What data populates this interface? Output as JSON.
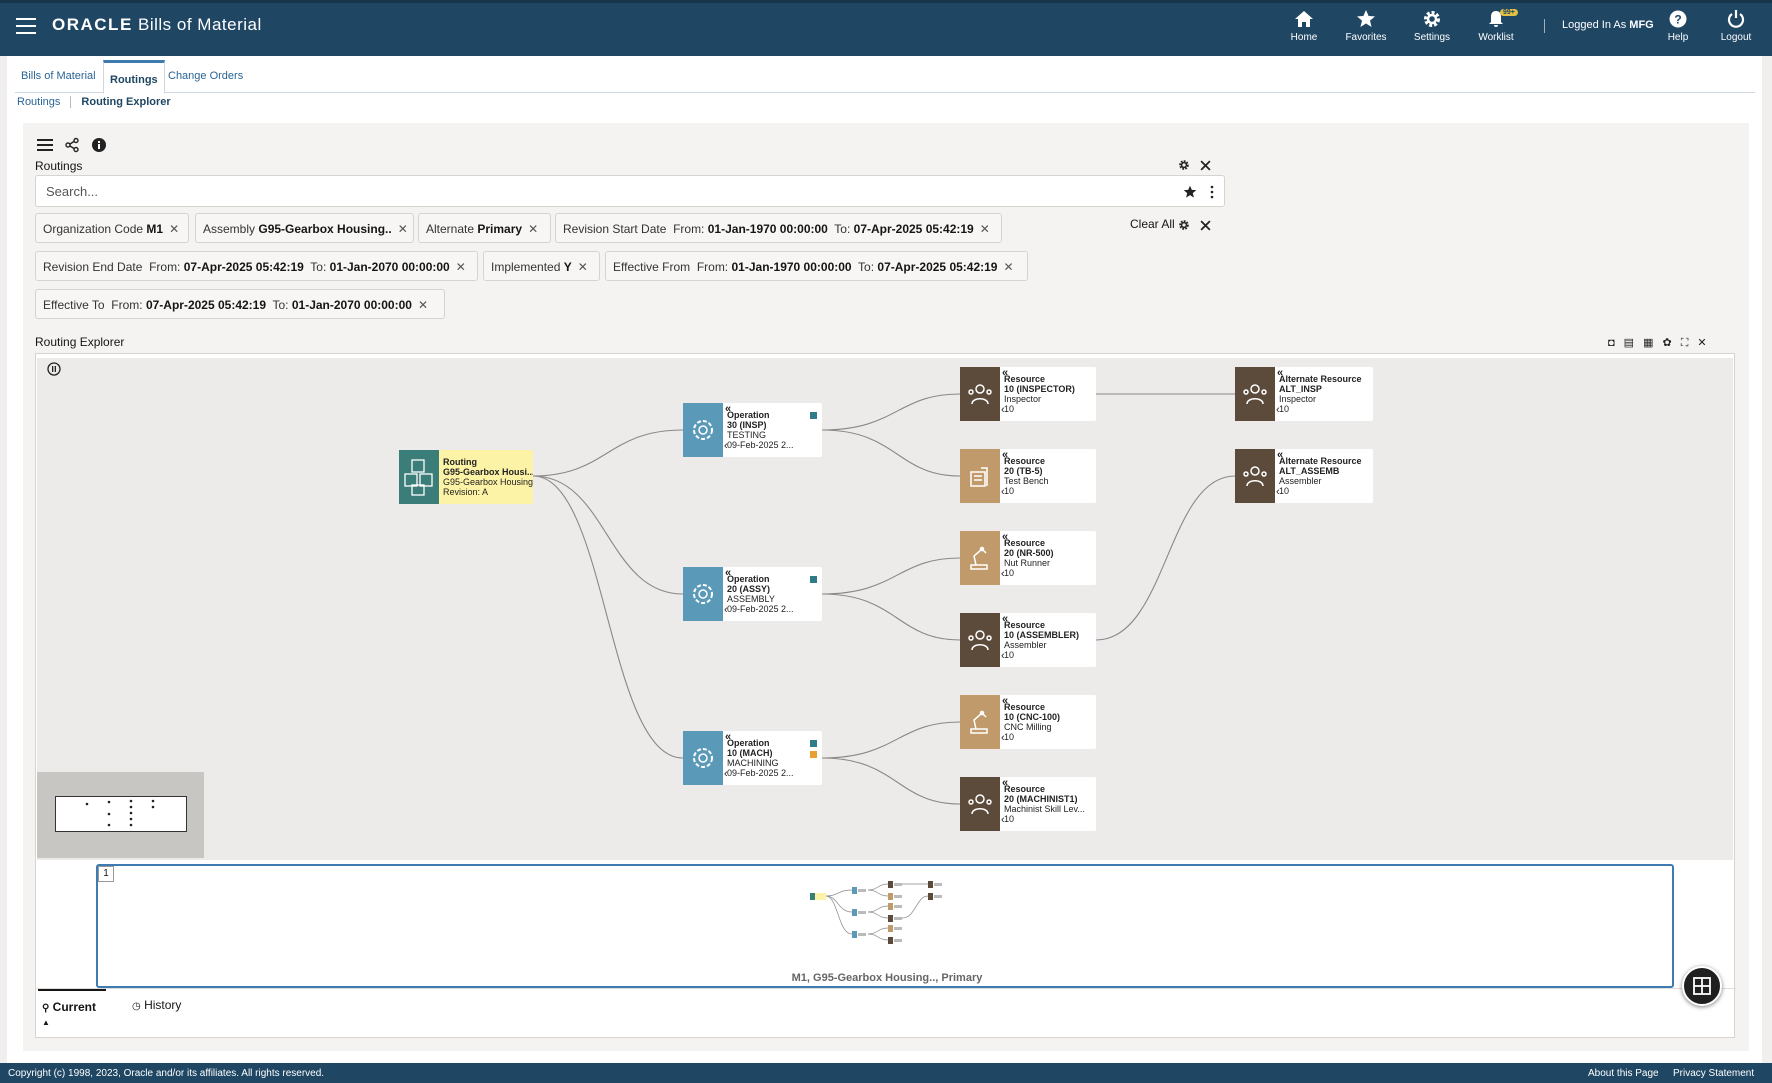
{
  "app": {
    "brand": "ORACLE",
    "title": "Bills of Material"
  },
  "nav": [
    {
      "label": "Home",
      "icon": "home-icon"
    },
    {
      "label": "Favorites",
      "icon": "star-icon"
    },
    {
      "label": "Settings",
      "icon": "gear-icon"
    },
    {
      "label": "Worklist",
      "icon": "bell-icon",
      "badge": "99+"
    },
    {
      "label": "Help",
      "icon": "help-icon"
    },
    {
      "label": "Logout",
      "icon": "power-icon"
    }
  ],
  "user": {
    "prefix": "Logged In As",
    "name": "MFG"
  },
  "tabs": [
    "Bills of Material",
    "Routings",
    "Change Orders"
  ],
  "subnav": [
    "Routings",
    "Routing Explorer"
  ],
  "routings": {
    "title": "Routings",
    "search_placeholder": "Search...",
    "clear_all": "Clear All"
  },
  "filters": [
    {
      "label": "Organization Code",
      "value": "M1"
    },
    {
      "label": "Assembly",
      "value": "G95-Gearbox Housing.."
    },
    {
      "label": "Alternate",
      "value": "Primary"
    },
    {
      "label": "Revision Start Date",
      "from_label": "From:",
      "from": "01-Jan-1970 00:00:00",
      "to_label": "To:",
      "to": "07-Apr-2025 05:42:19"
    },
    {
      "label": "Revision End Date",
      "from_label": "From:",
      "from": "07-Apr-2025 05:42:19",
      "to_label": "To:",
      "to": "01-Jan-2070 00:00:00"
    },
    {
      "label": "Implemented",
      "value": "Y"
    },
    {
      "label": "Effective From",
      "from_label": "From:",
      "from": "01-Jan-1970 00:00:00",
      "to_label": "To:",
      "to": "07-Apr-2025 05:42:19"
    },
    {
      "label": "Effective To",
      "from_label": "From:",
      "from": "07-Apr-2025 05:42:19",
      "to_label": "To:",
      "to": "01-Jan-2070 00:00:00"
    }
  ],
  "explorer": {
    "title": "Routing Explorer",
    "routing": {
      "type": "Routing",
      "name": "G95-Gearbox Housi...",
      "desc": "G95-Gearbox Housing",
      "rev": "Revision: A"
    },
    "operations": [
      {
        "type": "Operation",
        "code": "30 (INSP)",
        "name": "TESTING",
        "date": "09-Feb-2025 2..."
      },
      {
        "type": "Operation",
        "code": "20 (ASSY)",
        "name": "ASSEMBLY",
        "date": "09-Feb-2025 2..."
      },
      {
        "type": "Operation",
        "code": "10 (MACH)",
        "name": "MACHINING",
        "date": "09-Feb-2025 2..."
      }
    ],
    "resources": [
      {
        "type": "Resource",
        "code": "10 (INSPECTOR)",
        "name": "Inspector",
        "qty": "10"
      },
      {
        "type": "Resource",
        "code": "20 (TB-5)",
        "name": "Test Bench",
        "qty": "10"
      },
      {
        "type": "Resource",
        "code": "20 (NR-500)",
        "name": "Nut Runner",
        "qty": "10"
      },
      {
        "type": "Resource",
        "code": "10 (ASSEMBLER)",
        "name": "Assembler",
        "qty": "10"
      },
      {
        "type": "Resource",
        "code": "10 (CNC-100)",
        "name": "CNC Milling",
        "qty": "10"
      },
      {
        "type": "Resource",
        "code": "20 (MACHINIST1)",
        "name": "Machinist Skill Lev...",
        "qty": "10"
      }
    ],
    "alternates": [
      {
        "type": "Alternate Resource",
        "code": "ALT_INSP",
        "name": "Inspector",
        "qty": "10"
      },
      {
        "type": "Alternate Resource",
        "code": "ALT_ASSEMB",
        "name": "Assembler",
        "qty": "10"
      }
    ],
    "overview_num": "1",
    "overview_caption": "M1, G95-Gearbox Housing.., Primary",
    "bottom_tabs": [
      "Current",
      "History"
    ]
  },
  "footer": {
    "copyright": "Copyright (c) 1998, 2023, Oracle and/or its affiliates. All rights reserved.",
    "about": "About this Page",
    "privacy": "Privacy Statement"
  },
  "colors": {
    "header": "#1f4663",
    "operation": "#5a9ab8",
    "resource_dark": "#5c4a3a",
    "resource_light": "#c19a6b",
    "routing": "#3b7d78",
    "routing_bg": "#fdf3a6"
  }
}
